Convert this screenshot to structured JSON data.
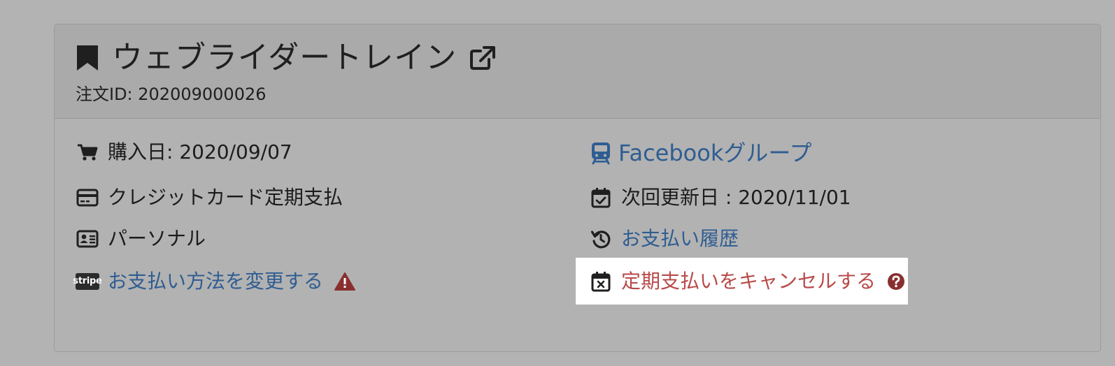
{
  "header": {
    "title": "ウェブライダートレイン",
    "order_id": "注文ID: 202009000026",
    "icons": {
      "title": "bookmark-icon",
      "external": "external-link-icon"
    }
  },
  "left": {
    "purchase_date": "購入日: 2020/09/07",
    "payment_type": "クレジットカード定期支払",
    "account_type": "パーソナル",
    "stripe_badge": "stripe",
    "change_payment": "お支払い方法を変更する"
  },
  "right": {
    "facebook_group": "Facebookグループ",
    "next_renewal": "次回更新日 : 2020/11/01",
    "payment_history": "お支払い履歴",
    "cancel_subscription": "定期支払いをキャンセルする"
  },
  "colors": {
    "link": "#2f5d91",
    "danger": "#b84a4a",
    "warning_icon": "#8a2f2f",
    "text": "#1c1c1c"
  }
}
